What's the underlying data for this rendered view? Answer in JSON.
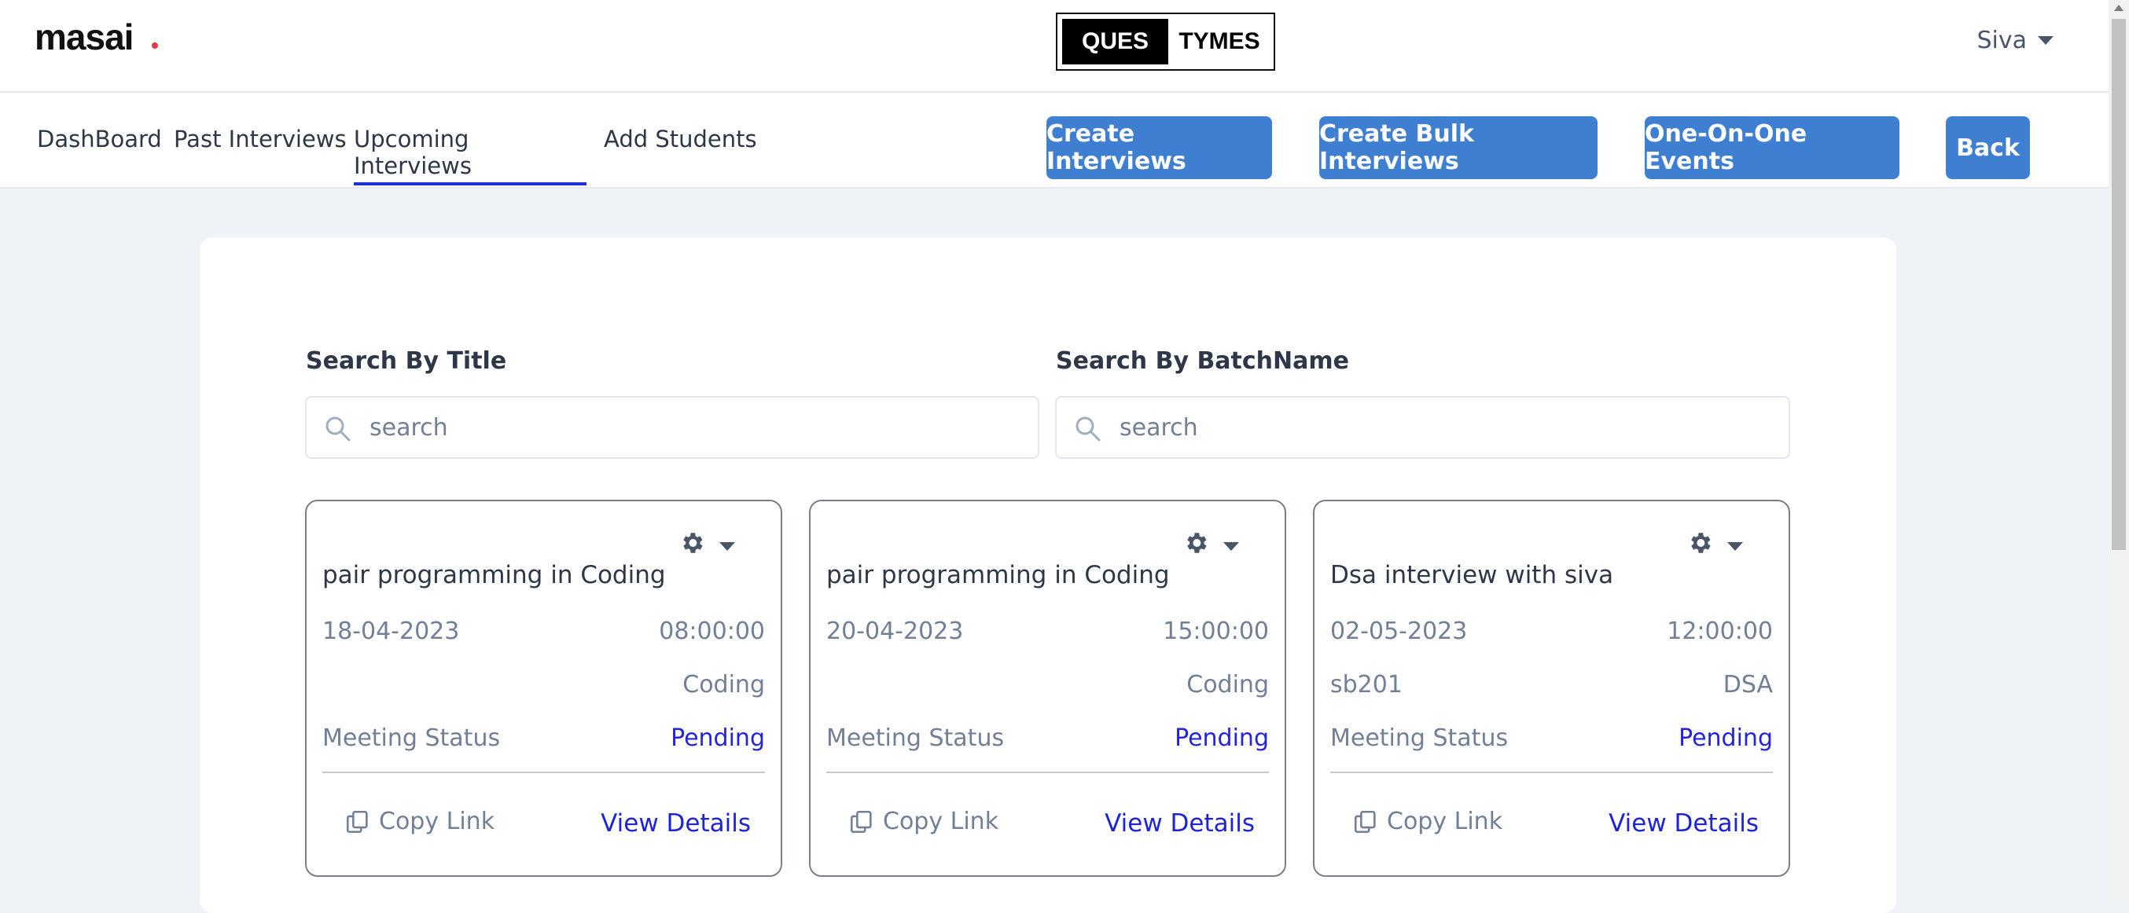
{
  "header": {
    "logo": "masai",
    "brand_left": "QUES",
    "brand_right": "TYMES",
    "user_name": "Siva"
  },
  "nav": {
    "tabs": [
      "DashBoard",
      "Past Interviews",
      "Upcoming Interviews",
      "Add Students"
    ],
    "active_tab": "Upcoming Interviews",
    "buttons": [
      "Create Interviews",
      "Create Bulk Interviews",
      "One-On-One Events",
      "Back"
    ]
  },
  "filters": {
    "title_label": "Search By Title",
    "title_placeholder": "search",
    "batch_label": "Search By BatchName",
    "batch_placeholder": "search"
  },
  "cards": [
    {
      "title": "pair programming in Coding",
      "date": "18-04-2023",
      "time": "08:00:00",
      "batch": "",
      "category": "Coding",
      "status_label": "Meeting Status",
      "status": "Pending",
      "copy_label": "Copy Link",
      "details_label": "View Details"
    },
    {
      "title": "pair programming in Coding",
      "date": "20-04-2023",
      "time": "15:00:00",
      "batch": "",
      "category": "Coding",
      "status_label": "Meeting Status",
      "status": "Pending",
      "copy_label": "Copy Link",
      "details_label": "View Details"
    },
    {
      "title": "Dsa interview with siva",
      "date": "02-05-2023",
      "time": "12:00:00",
      "batch": "sb201",
      "category": "DSA",
      "status_label": "Meeting Status",
      "status": "Pending",
      "copy_label": "Copy Link",
      "details_label": "View Details"
    }
  ],
  "colors": {
    "primary_button": "#3f7fd2",
    "active_tab_underline": "#1f2fd6",
    "pending": "#2323e0",
    "page_bg": "#eff3f8"
  },
  "icons": {
    "search": "search-icon",
    "settings": "gear-icon",
    "copy": "copy-icon",
    "user_menu": "chevron-down-icon"
  }
}
